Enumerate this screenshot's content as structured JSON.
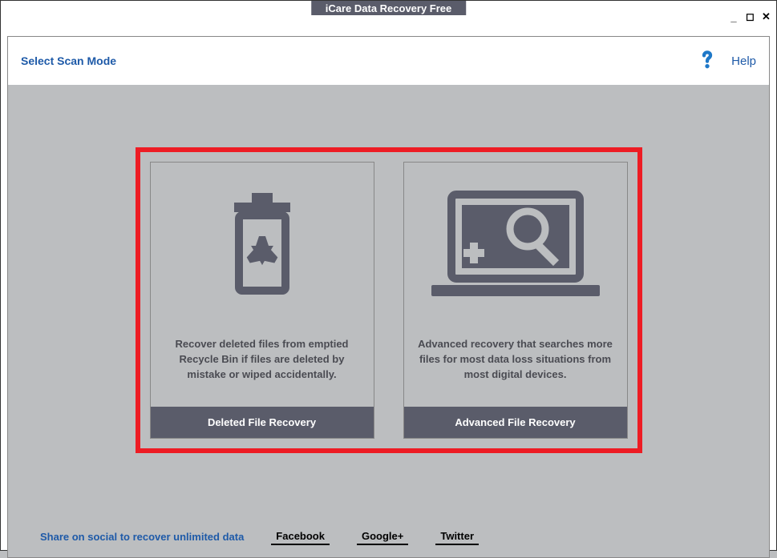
{
  "window": {
    "title": "iCare Data Recovery Free"
  },
  "header": {
    "scan_mode_label": "Select Scan Mode",
    "help_label": "Help"
  },
  "modes": {
    "deleted": {
      "description": "Recover deleted files from emptied Recycle Bin if files are deleted by mistake or wiped accidentally.",
      "title": "Deleted File Recovery"
    },
    "advanced": {
      "description": "Advanced recovery that searches more files for most data loss situations from most digital devices.",
      "title": "Advanced File Recovery"
    }
  },
  "footer": {
    "share_label": "Share on social to recover unlimited data",
    "facebook": "Facebook",
    "google": "Google+",
    "twitter": "Twitter"
  }
}
